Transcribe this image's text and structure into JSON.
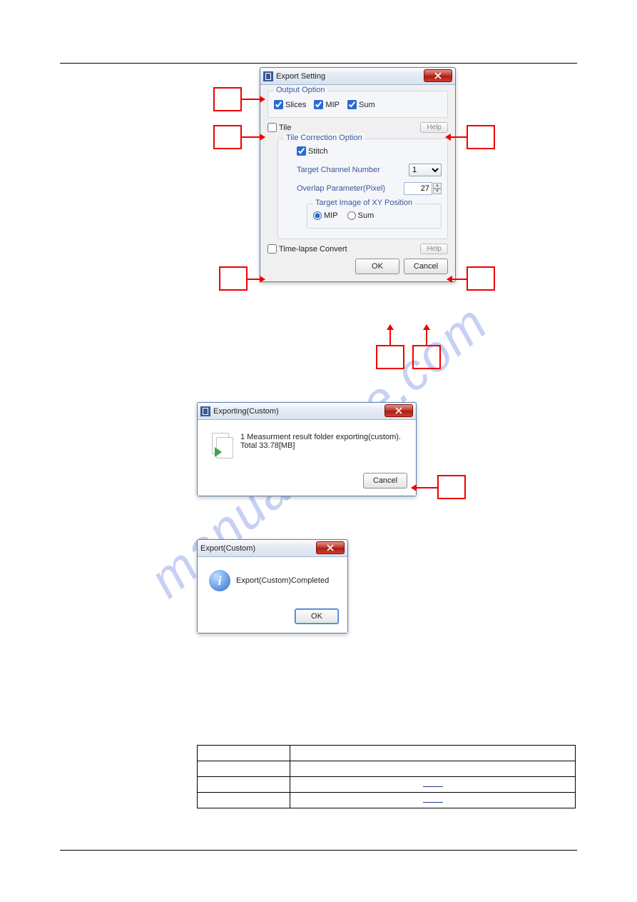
{
  "watermark": "manualshive.com",
  "dialog1": {
    "title": "Export Setting",
    "output_option_legend": "Output Option",
    "slices_label": "Slices",
    "mip_label": "MIP",
    "sum_label": "Sum",
    "tile_label": "Tile",
    "help_label": "Help",
    "tile_correction_legend": "Tile Correction Option",
    "stitch_label": "Stitch",
    "target_channel_label": "Target Channel Number",
    "target_channel_value": "1",
    "overlap_label": "Overlap Parameter(Pixel)",
    "overlap_value": "27",
    "target_image_legend": "Target Image of XY Position",
    "radio_mip": "MIP",
    "radio_sum": "Sum",
    "timelapse_label": "Time-lapse Convert",
    "ok_label": "OK",
    "cancel_label": "Cancel"
  },
  "dialog2": {
    "title": "Exporting(Custom)",
    "line1": "1 Measurment result folder exporting(custom).",
    "line2": "Total 33.78[MB]",
    "cancel_label": "Cancel"
  },
  "dialog3": {
    "title": "Export(Custom)",
    "message": "Export(Custom)Completed",
    "ok_label": "OK"
  }
}
